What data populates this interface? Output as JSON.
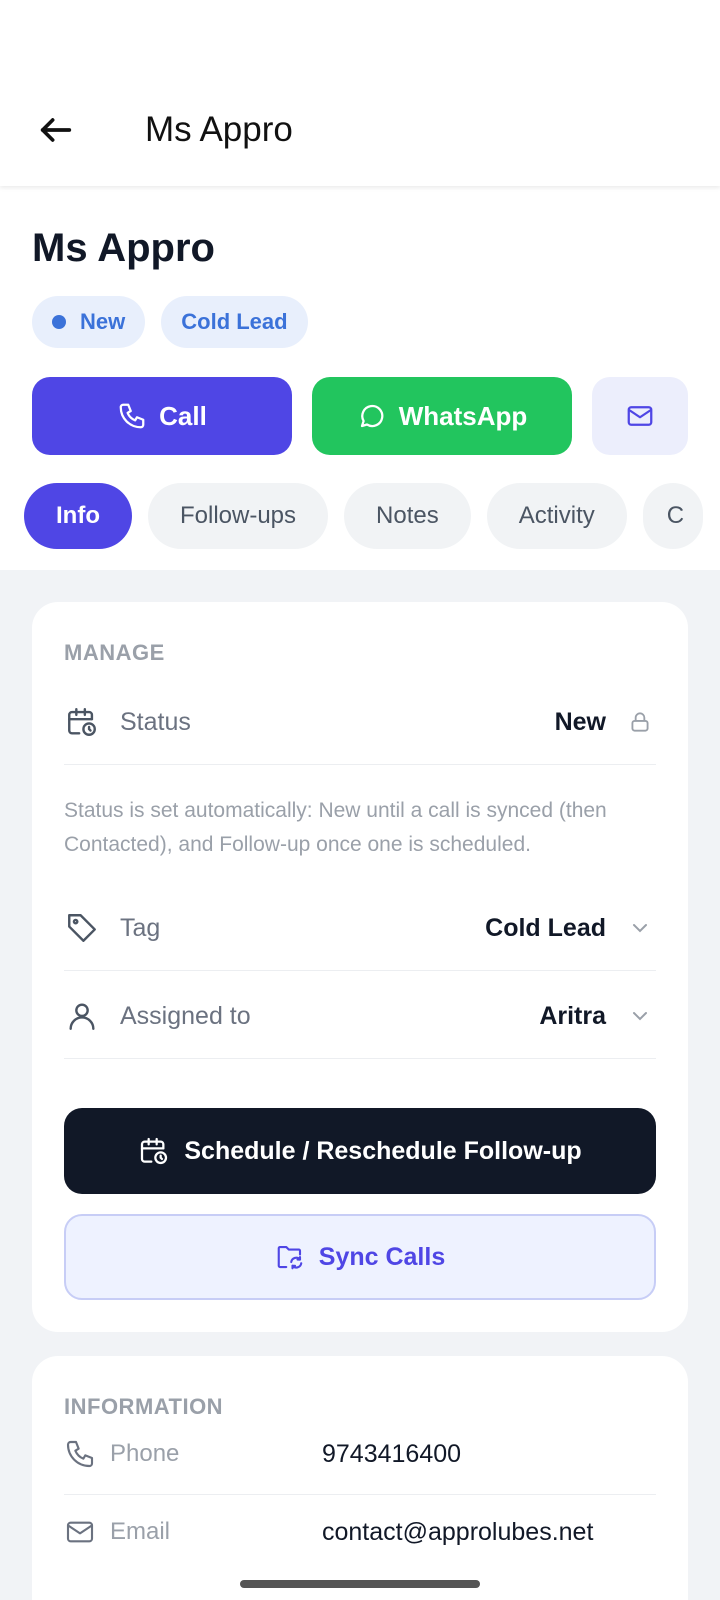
{
  "appbar": {
    "title": "Ms Appro"
  },
  "lead": {
    "name": "Ms Appro",
    "status_chip": "New",
    "tag_chip": "Cold Lead"
  },
  "actions": {
    "call": "Call",
    "whatsapp": "WhatsApp"
  },
  "tabs": [
    {
      "label": "Info",
      "active": true
    },
    {
      "label": "Follow-ups"
    },
    {
      "label": "Notes"
    },
    {
      "label": "Activity"
    },
    {
      "label": "C"
    }
  ],
  "manage": {
    "title": "MANAGE",
    "status_label": "Status",
    "status_value": "New",
    "status_note": "Status is set automatically: New until a call is synced (then Contacted), and Follow-up once one is scheduled.",
    "tag_label": "Tag",
    "tag_value": "Cold Lead",
    "assigned_label": "Assigned to",
    "assigned_value": "Aritra",
    "schedule_button": "Schedule / Reschedule Follow-up",
    "sync_button": "Sync Calls"
  },
  "information": {
    "title": "INFORMATION",
    "phone_label": "Phone",
    "phone_value": "9743416400",
    "email_label": "Email",
    "email_value": "contact@approlubes.net"
  },
  "colors": {
    "primary": "#4f46e5",
    "whatsapp": "#22c55e",
    "dark": "#111827",
    "chip_bg": "#e8effc",
    "chip_text": "#3b72d9"
  }
}
